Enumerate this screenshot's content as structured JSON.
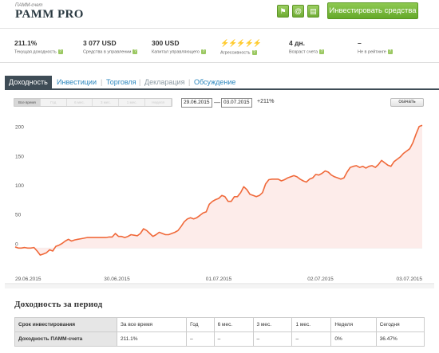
{
  "header": {
    "subtitle": "ПАММ-счет",
    "title": "PAMM PRO",
    "icons": [
      "bookmark-icon",
      "email-icon",
      "briefcase-icon"
    ],
    "invest_button": "Инвестировать средства"
  },
  "stats": [
    {
      "value": "211.1%",
      "label": "Текущая доходность"
    },
    {
      "value": "3 077 USD",
      "label": "Средства в управлении"
    },
    {
      "value": "300 USD",
      "label": "Капитал управляющего"
    },
    {
      "value": "⚡⚡⚡⚡⚡",
      "label": "Агрессивность"
    },
    {
      "value": "4 дн.",
      "label": "Возраст счета"
    },
    {
      "value": "–",
      "label": "Не в рейтинге"
    }
  ],
  "tabs": [
    {
      "label": "Доходность",
      "state": "active"
    },
    {
      "label": "Инвестиции",
      "state": "link"
    },
    {
      "label": "Торговля",
      "state": "link"
    },
    {
      "label": "Декларация",
      "state": "muted"
    },
    {
      "label": "Обсуждение",
      "state": "link"
    }
  ],
  "controls": {
    "periods": [
      "Все время",
      "Год",
      "6 мес.",
      "3 мес.",
      "1 мес.",
      "Неделя"
    ],
    "active_period": "Все время",
    "date_from": "29.06.2015",
    "dash": "—",
    "date_to": "03.07.2015",
    "change": "+211%",
    "download": "скачать"
  },
  "chart_data": {
    "type": "area",
    "title": "",
    "xlabel": "",
    "ylabel": "",
    "ylim": [
      -50,
      220
    ],
    "yticks": [
      "200",
      "150",
      "100",
      "50",
      "0"
    ],
    "xtick_labels": [
      "29.06.2015",
      "30.06.2015",
      "01.07.2015",
      "02.07.2015",
      "03.07.2015"
    ],
    "grid": false,
    "color": "#f0693a",
    "fill": "#fdecea",
    "x_start": "29.06.2015",
    "x_end": "03.07.2015",
    "values": [
      2,
      0,
      0,
      1,
      0,
      0,
      1,
      -5,
      -12,
      -10,
      -8,
      -3,
      -5,
      3,
      5,
      8,
      12,
      15,
      12,
      14,
      15,
      16,
      17,
      18,
      18,
      18,
      18,
      18,
      18,
      18,
      19,
      19,
      25,
      20,
      20,
      18,
      20,
      23,
      22,
      21,
      25,
      33,
      30,
      25,
      20,
      23,
      27,
      25,
      23,
      23,
      25,
      27,
      30,
      37,
      45,
      50,
      52,
      50,
      52,
      56,
      60,
      62,
      75,
      80,
      83,
      85,
      90,
      88,
      80,
      80,
      88,
      88,
      95,
      105,
      100,
      92,
      90,
      88,
      90,
      95,
      110,
      117,
      118,
      118,
      118,
      115,
      117,
      120,
      122,
      124,
      122,
      118,
      115,
      113,
      118,
      120,
      126,
      125,
      128,
      132,
      130,
      125,
      122,
      120,
      118,
      120,
      130,
      138,
      140,
      141,
      138,
      140,
      137,
      140,
      141,
      138,
      143,
      150,
      146,
      142,
      140,
      148,
      152,
      156,
      162,
      166,
      170,
      180,
      195,
      208,
      210
    ]
  },
  "section_title": "Доходность за период",
  "yield_table": {
    "header": [
      "Срок инвестирования",
      "За все время",
      "Год",
      "6 мес.",
      "3 мес.",
      "1 мес.",
      "Неделя",
      "Сегодня"
    ],
    "row": [
      "Доходность ПАММ-счета",
      "211.1%",
      "–",
      "–",
      "–",
      "–",
      "0%",
      "36.47%"
    ]
  }
}
